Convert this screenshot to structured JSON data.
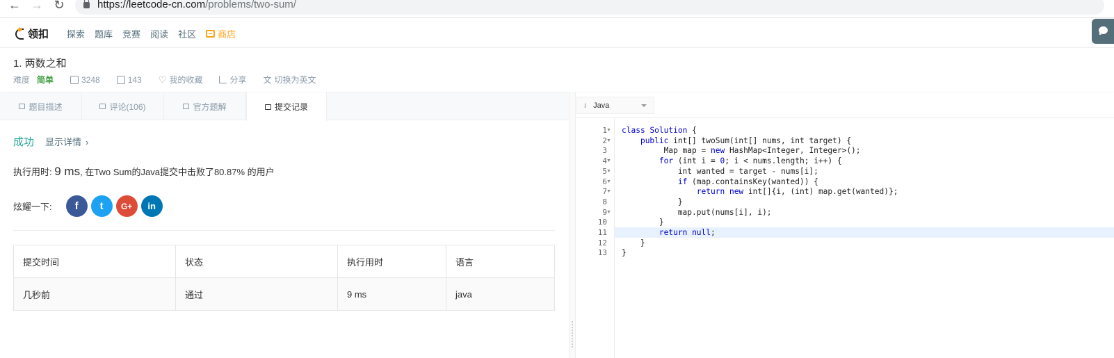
{
  "browser": {
    "url_main": "https://leetcode-cn.com",
    "url_path": "/problems/two-sum/"
  },
  "site": {
    "logo_text": "领扣",
    "nav": [
      "探索",
      "题库",
      "竞赛",
      "阅读",
      "社区"
    ],
    "store_label": "商店"
  },
  "problem": {
    "title": "1.  两数之和",
    "difficulty_label": "难度",
    "difficulty": "简单",
    "likes": "3248",
    "dislikes": "143",
    "favorite": "我的收藏",
    "share": "分享",
    "translate": "切换为英文"
  },
  "tabs": [
    {
      "label": "题目描述"
    },
    {
      "label": "评论(106)"
    },
    {
      "label": "官方题解"
    },
    {
      "label": "提交记录"
    }
  ],
  "result": {
    "status": "成功",
    "details_link": "显示详情",
    "runtime_prefix": "执行用时: ",
    "runtime_value": "9 ms",
    "runtime_suffix": ", 在Two Sum的Java提交中击败了80.87% 的用户",
    "share_label": "炫耀一下:"
  },
  "table": {
    "headers": [
      "提交时间",
      "状态",
      "执行用时",
      "语言"
    ],
    "rows": [
      [
        "几秒前",
        "通过",
        "9 ms",
        "java"
      ]
    ]
  },
  "editor": {
    "language": "Java",
    "line_numbers": [
      "1",
      "2",
      "3",
      "4",
      "5",
      "6",
      "7",
      "8",
      "9",
      "10",
      "11",
      "12",
      "13"
    ],
    "fold_lines": [
      1,
      2,
      4,
      5,
      6,
      7,
      9
    ],
    "active_line": 11,
    "code": [
      "class Solution {",
      "    public int[] twoSum(int[] nums, int target) {",
      "         Map map = new HashMap<Integer, Integer>();",
      "        for (int i = 0; i < nums.length; i++) {",
      "            int wanted = target - nums[i];",
      "            if (map.containsKey(wanted)) {",
      "                return new int[]{i, (int) map.get(wanted)};",
      "            }",
      "            map.put(nums[i], i);",
      "        }",
      "        return null;",
      "    }",
      "}"
    ]
  },
  "colors": {
    "success": "#26a69a",
    "store": "#ffa116",
    "keyword": "#0000cc"
  }
}
